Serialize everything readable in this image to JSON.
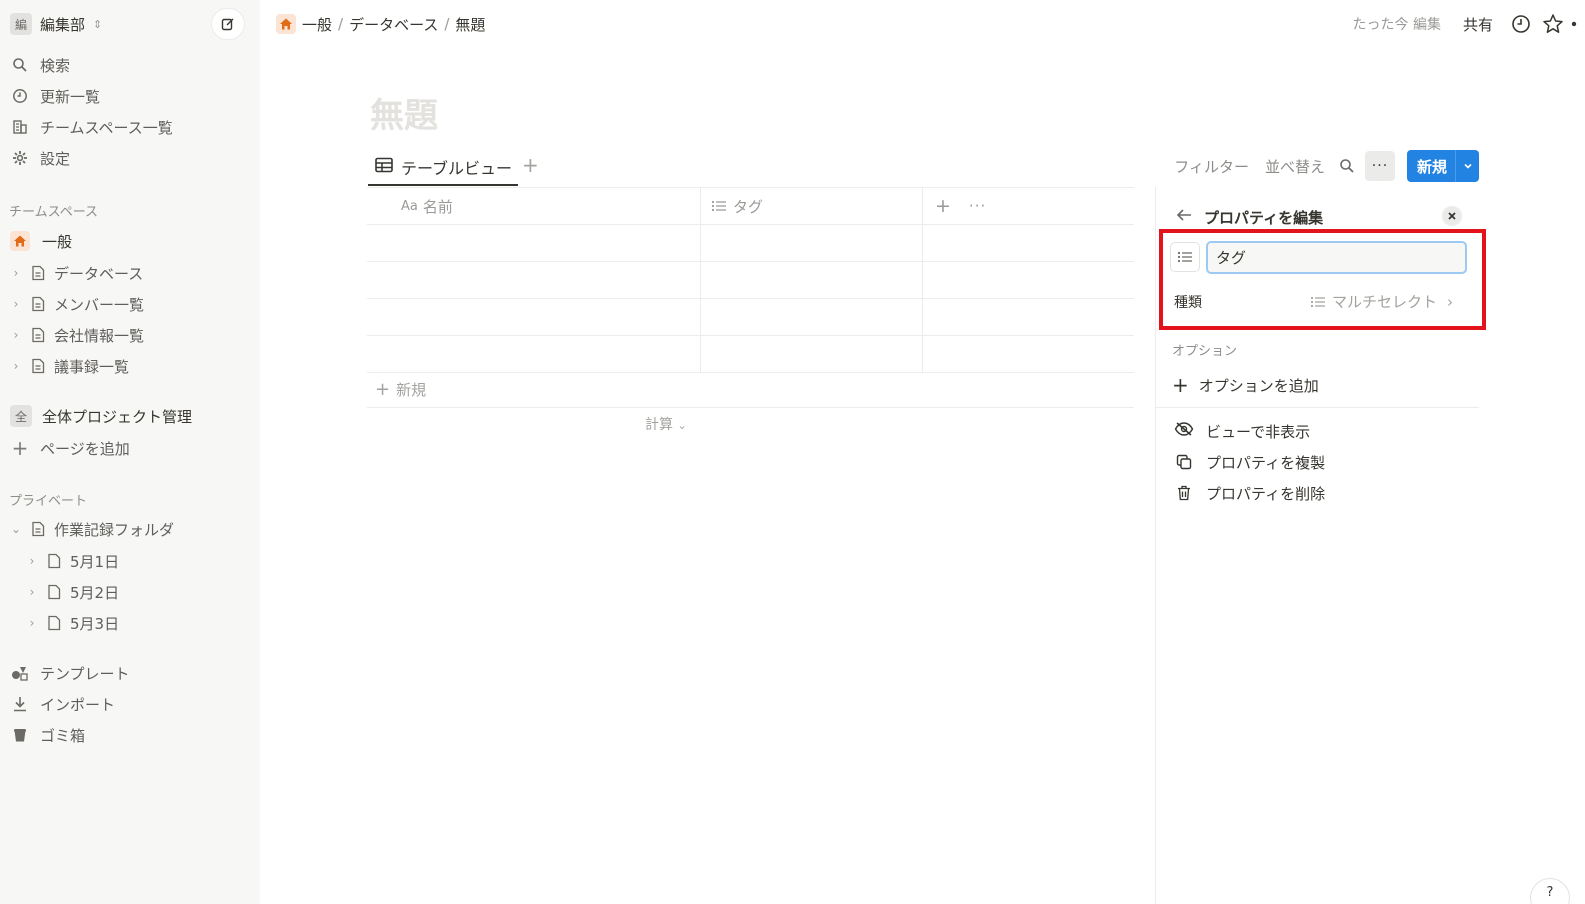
{
  "workspace": {
    "badge": "編",
    "name": "編集部"
  },
  "sidebar": {
    "nav": [
      {
        "label": "検索",
        "icon": "search-icon"
      },
      {
        "label": "更新一覧",
        "icon": "clock-icon"
      },
      {
        "label": "チームスペース一覧",
        "icon": "building-icon"
      },
      {
        "label": "設定",
        "icon": "gear-icon"
      }
    ],
    "teamspace_label": "チームスペース",
    "teamspace_home": "一般",
    "teamspace_pages": [
      "データベース",
      "メンバー一覧",
      "会社情報一覧",
      "議事録一覧"
    ],
    "project": {
      "badge": "全",
      "label": "全体プロジェクト管理"
    },
    "add_page": "ページを追加",
    "private_label": "プライベート",
    "private_folder": "作業記録フォルダ",
    "private_pages": [
      "5月1日",
      "5月2日",
      "5月3日"
    ],
    "bottom": [
      {
        "label": "テンプレート",
        "icon": "template-icon"
      },
      {
        "label": "インポート",
        "icon": "import-icon"
      },
      {
        "label": "ゴミ箱",
        "icon": "trash-icon"
      }
    ]
  },
  "breadcrumb": {
    "items": [
      "一般",
      "データベース",
      "無題"
    ],
    "sep": "/"
  },
  "topbar": {
    "edited": "たった今 編集",
    "share": "共有"
  },
  "page": {
    "title": "無題"
  },
  "view": {
    "tab_label": "テーブルビュー",
    "add": "+"
  },
  "toolbar": {
    "filter": "フィルター",
    "sort": "並べ替え",
    "more": "···",
    "new": "新規"
  },
  "table": {
    "columns": [
      {
        "prefix": "Aa",
        "label": "名前"
      },
      {
        "label": "タグ"
      }
    ],
    "add_column": "+",
    "col_more": "···",
    "row_count": 4,
    "new_row": "新規",
    "calc": "計算"
  },
  "panel": {
    "title": "プロパティを編集",
    "name_value": "タグ",
    "kind_label": "種類",
    "kind_value": "マルチセレクト",
    "options_label": "オプション",
    "add_option": "オプションを追加",
    "actions": [
      {
        "label": "ビューで非表示",
        "icon": "eye-off-icon"
      },
      {
        "label": "プロパティを複製",
        "icon": "duplicate-icon"
      },
      {
        "label": "プロパティを削除",
        "icon": "trash-icon"
      }
    ]
  },
  "help": "?",
  "colors": {
    "accent": "#2383e2",
    "highlight": "#e3131b",
    "home": "#e16b16"
  }
}
